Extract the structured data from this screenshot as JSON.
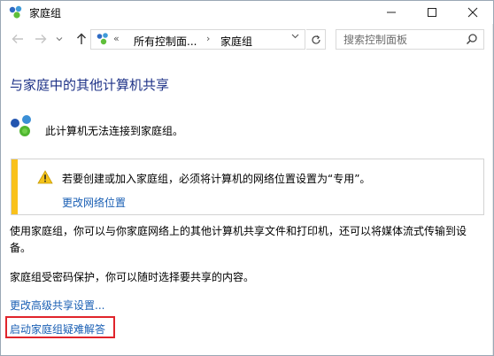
{
  "window": {
    "title": "家庭组"
  },
  "address_bar": {
    "breadcrumb_overflow": "«",
    "crumbs": [
      "所有控制面...",
      "家庭组"
    ],
    "separator": "›"
  },
  "search": {
    "placeholder": "搜索控制面板"
  },
  "main": {
    "heading": "与家庭中的其他计算机共享",
    "status_text": "此计算机无法连接到家庭组。",
    "warning": {
      "message": "若要创建或加入家庭组，必须将计算机的网络位置设置为“专用”。",
      "link": "更改网络位置"
    },
    "description": "使用家庭组，你可以与你家庭网络上的其他计算机共享文件和打印机，还可以将媒体流式传输到设备。",
    "password_note": "家庭组受密码保护，你可以随时选择要共享的内容。",
    "link_advanced": "更改高级共享设置...",
    "link_troubleshoot": "启动家庭组疑难解答"
  },
  "icons": {
    "app": "homegroup-icon",
    "back": "back-arrow-icon",
    "forward": "forward-arrow-icon",
    "up": "up-arrow-icon",
    "refresh": "refresh-icon",
    "search": "search-icon",
    "warning": "warning-icon"
  },
  "colors": {
    "heading": "#1e3287",
    "link": "#1a5fb4",
    "warning_bar": "#f9c11c",
    "highlight_border": "#e0242b"
  }
}
